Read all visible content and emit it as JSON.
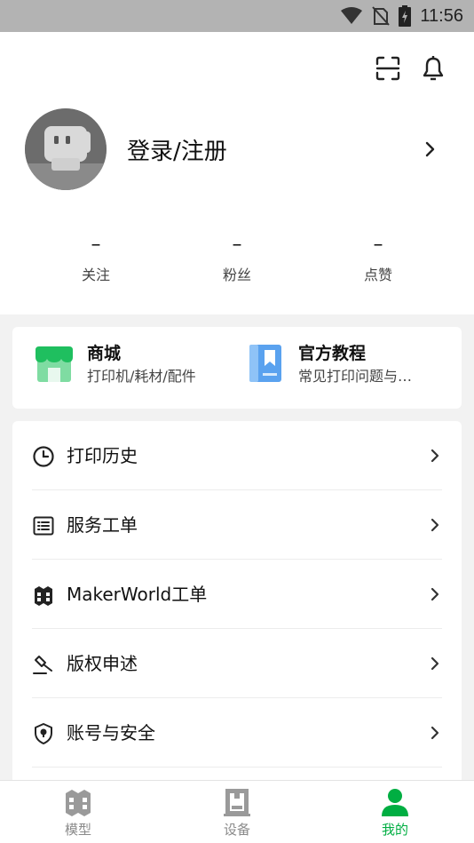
{
  "status_bar": {
    "time": "11:56"
  },
  "profile": {
    "login_label": "登录/注册"
  },
  "stats": [
    {
      "value": "–",
      "label": "关注"
    },
    {
      "value": "–",
      "label": "粉丝"
    },
    {
      "value": "–",
      "label": "点赞"
    }
  ],
  "shortcuts": [
    {
      "title": "商城",
      "subtitle": "打印机/耗材/配件",
      "icon": "store-icon"
    },
    {
      "title": "官方教程",
      "subtitle": "常见打印问题与…",
      "icon": "book-icon"
    }
  ],
  "menu": [
    {
      "label": "打印历史",
      "icon": "clock-icon"
    },
    {
      "label": "服务工单",
      "icon": "list-icon"
    },
    {
      "label": "MakerWorld工单",
      "icon": "makerworld-icon"
    },
    {
      "label": "版权申述",
      "icon": "gavel-icon"
    },
    {
      "label": "账号与安全",
      "icon": "shield-icon"
    }
  ],
  "tabs": [
    {
      "label": "模型",
      "icon": "model-icon",
      "active": false
    },
    {
      "label": "设备",
      "icon": "device-icon",
      "active": false
    },
    {
      "label": "我的",
      "icon": "person-icon",
      "active": true
    }
  ],
  "colors": {
    "accent": "#00ae42",
    "status_bar": "#b3b3b3",
    "background": "#f2f2f2"
  }
}
